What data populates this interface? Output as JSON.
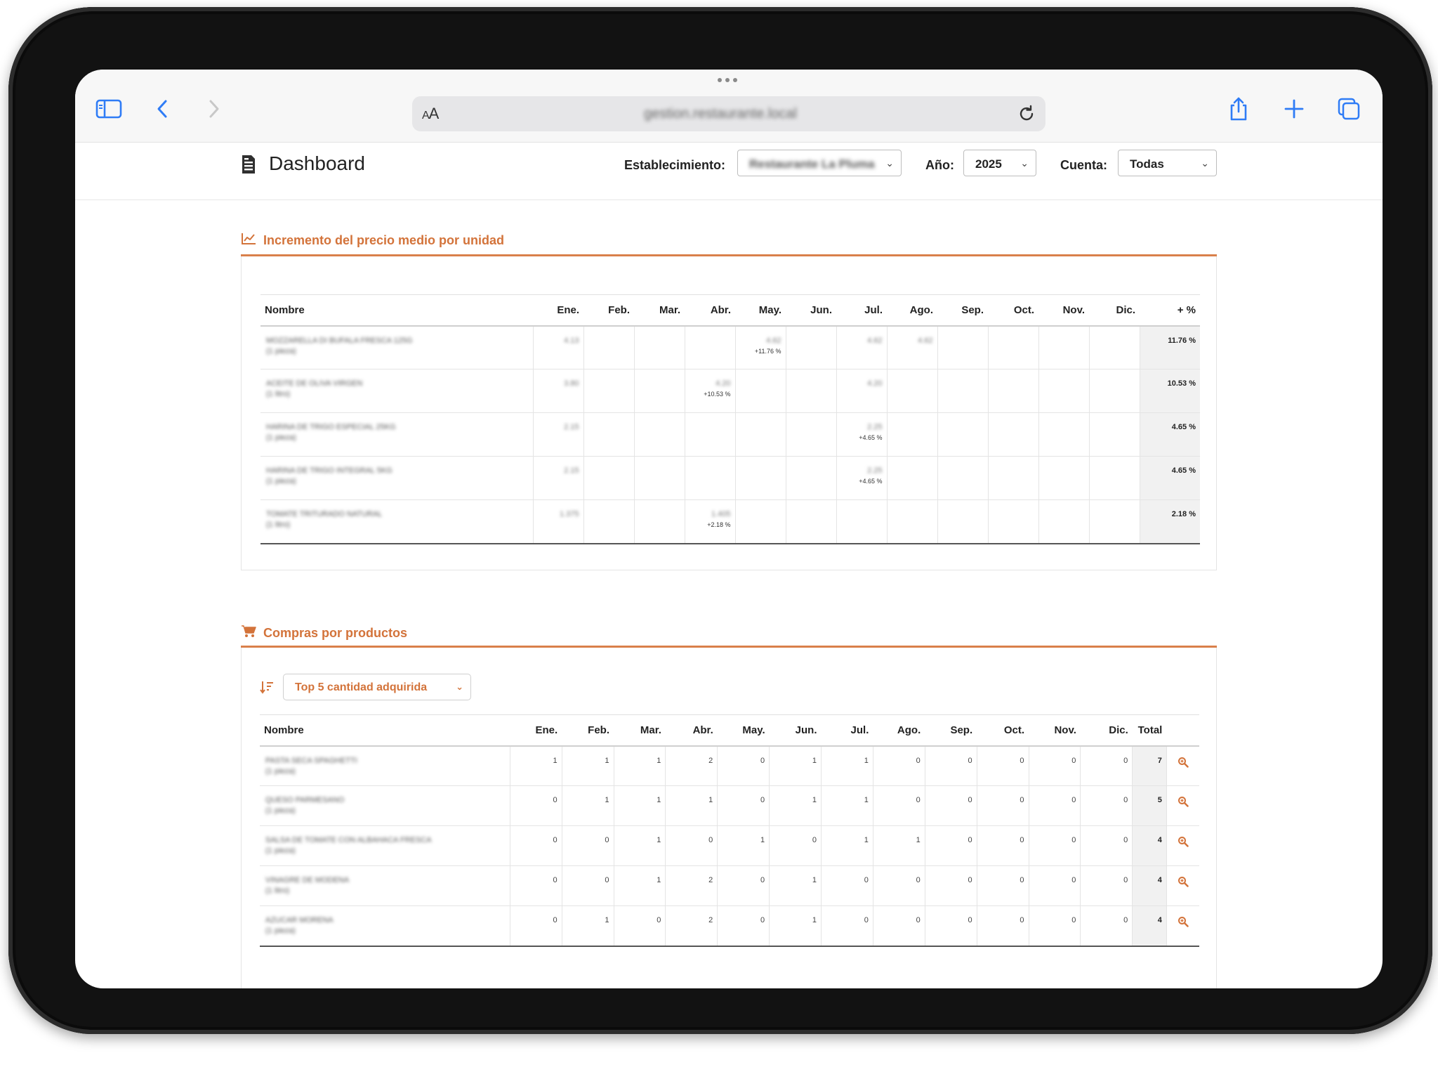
{
  "browser": {
    "aa_small": "A",
    "aa_large": "A",
    "url": "gestion.restaurante.local"
  },
  "header": {
    "title": "Dashboard",
    "establecimiento_label": "Establecimiento:",
    "establecimiento_value": "Restaurante La Pluma",
    "anio_label": "Año:",
    "anio_value": "2025",
    "cuenta_label": "Cuenta:",
    "cuenta_value": "Todas"
  },
  "price_section": {
    "title": "Incremento del precio medio por unidad",
    "columns": [
      "Nombre",
      "Ene.",
      "Feb.",
      "Mar.",
      "Abr.",
      "May.",
      "Jun.",
      "Jul.",
      "Ago.",
      "Sep.",
      "Oct.",
      "Nov.",
      "Dic.",
      "+ %"
    ],
    "rows": [
      {
        "name": "MOZZARELLA DI BUFALA FRESCA 125G",
        "unit": "(1 pieza)",
        "cells": [
          "4.13",
          "",
          "",
          "",
          "4.62",
          "",
          "4.62",
          "4.62",
          "",
          "",
          "",
          ""
        ],
        "inc": [
          "",
          "",
          "",
          "",
          "+11.76 %",
          "",
          "",
          "",
          "",
          "",
          "",
          ""
        ],
        "pct": "11.76 %"
      },
      {
        "name": "ACEITE DE OLIVA VIRGEN",
        "unit": "(1 litro)",
        "cells": [
          "3.80",
          "",
          "",
          "4.20",
          "",
          "",
          "4.20",
          "",
          "",
          "",
          "",
          ""
        ],
        "inc": [
          "",
          "",
          "",
          "+10.53 %",
          "",
          "",
          "",
          "",
          "",
          "",
          "",
          ""
        ],
        "pct": "10.53 %"
      },
      {
        "name": "HARINA DE TRIGO ESPECIAL 25KG",
        "unit": "(1 pieza)",
        "cells": [
          "2.15",
          "",
          "",
          "",
          "",
          "",
          "2.25",
          "",
          "",
          "",
          "",
          ""
        ],
        "inc": [
          "",
          "",
          "",
          "",
          "",
          "",
          "+4.65 %",
          "",
          "",
          "",
          "",
          ""
        ],
        "pct": "4.65 %"
      },
      {
        "name": "HARINA DE TRIGO INTEGRAL 5KG",
        "unit": "(1 pieza)",
        "cells": [
          "2.15",
          "",
          "",
          "",
          "",
          "",
          "2.25",
          "",
          "",
          "",
          "",
          ""
        ],
        "inc": [
          "",
          "",
          "",
          "",
          "",
          "",
          "+4.65 %",
          "",
          "",
          "",
          "",
          ""
        ],
        "pct": "4.65 %"
      },
      {
        "name": "TOMATE TRITURADO NATURAL",
        "unit": "(1 litro)",
        "cells": [
          "1.375",
          "",
          "",
          "1.405",
          "",
          "",
          "",
          "",
          "",
          "",
          "",
          ""
        ],
        "inc": [
          "",
          "",
          "",
          "+2.18 %",
          "",
          "",
          "",
          "",
          "",
          "",
          "",
          ""
        ],
        "pct": "2.18 %"
      }
    ]
  },
  "products_section": {
    "title": "Compras por productos",
    "sort_value": "Top 5 cantidad adquirida",
    "columns": [
      "Nombre",
      "Ene.",
      "Feb.",
      "Mar.",
      "Abr.",
      "May.",
      "Jun.",
      "Jul.",
      "Ago.",
      "Sep.",
      "Oct.",
      "Nov.",
      "Dic.",
      "Total"
    ],
    "rows": [
      {
        "name": "PASTA SECA SPAGHETTI",
        "unit": "(1 pieza)",
        "values": [
          "1",
          "1",
          "1",
          "2",
          "0",
          "1",
          "1",
          "0",
          "0",
          "0",
          "0",
          "0"
        ],
        "total": "7"
      },
      {
        "name": "QUESO PARMESANO",
        "unit": "(1 pieza)",
        "values": [
          "0",
          "1",
          "1",
          "1",
          "0",
          "1",
          "1",
          "0",
          "0",
          "0",
          "0",
          "0"
        ],
        "total": "5"
      },
      {
        "name": "SALSA DE TOMATE CON ALBAHACA FRESCA",
        "unit": "(1 pieza)",
        "values": [
          "0",
          "0",
          "1",
          "0",
          "1",
          "0",
          "1",
          "1",
          "0",
          "0",
          "0",
          "0"
        ],
        "total": "4"
      },
      {
        "name": "VINAGRE DE MODENA",
        "unit": "(1 litro)",
        "values": [
          "0",
          "0",
          "1",
          "2",
          "0",
          "1",
          "0",
          "0",
          "0",
          "0",
          "0",
          "0"
        ],
        "total": "4"
      },
      {
        "name": "AZUCAR MORENA",
        "unit": "(1 pieza)",
        "values": [
          "0",
          "1",
          "0",
          "2",
          "0",
          "1",
          "0",
          "0",
          "0",
          "0",
          "0",
          "0"
        ],
        "total": "4"
      }
    ]
  },
  "colors": {
    "accent": "#d3733a",
    "page_bg": "#ffffff",
    "highlight_col": "#f1f1f1"
  }
}
